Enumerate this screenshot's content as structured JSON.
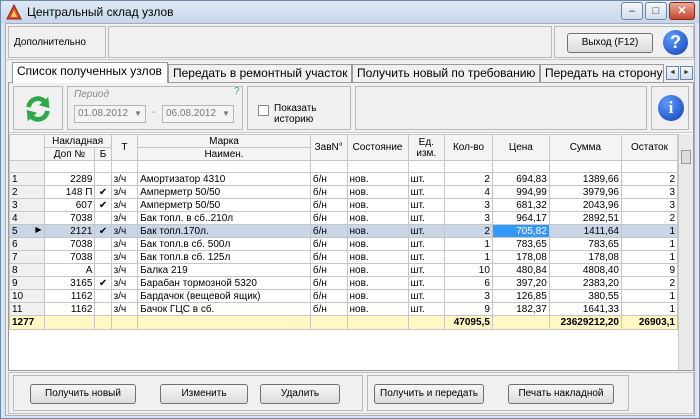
{
  "window": {
    "title": "Центральный склад узлов",
    "min": "–",
    "max": "□",
    "close": "✕"
  },
  "toolbar": {
    "extra_label": "Дополнительно",
    "exit_label": "Выход (F12)",
    "help_label": "?"
  },
  "tabs": [
    {
      "label": "Список полученных узлов"
    },
    {
      "label": "Передать в ремонтный участок"
    },
    {
      "label": "Получить новый по требованию"
    },
    {
      "label": "Передать на сторону"
    }
  ],
  "tab_nav": {
    "prev": "◄",
    "next": "►"
  },
  "filter": {
    "period_label": "Период",
    "date_from": "01.08.2012",
    "date_to": "06.08.2012",
    "dash": "-",
    "question": "?",
    "history_label": "Показать историю",
    "info_label": "i"
  },
  "grid": {
    "headers": {
      "nakl": "Накладная",
      "doc": "Доп №",
      "b": "Б",
      "t": "Т",
      "marka": "Марка",
      "naim": "Наимен.",
      "zav": "ЗавN°",
      "sost": "Состояние",
      "ed": "Ед. изм.",
      "kol": "Кол-во",
      "price": "Цена",
      "sum": "Сумма",
      "ost": "Остаток"
    },
    "rows": [
      {
        "n": "1",
        "doc": "2289",
        "b": "",
        "t": "з/ч",
        "name": "Амортизатор 4310",
        "zav": "б/н",
        "sost": "нов.",
        "ed": "шт.",
        "kol": "2",
        "price": "694,83",
        "sum": "1389,66",
        "ost": "2"
      },
      {
        "n": "2",
        "doc": "148 П",
        "b": "✔",
        "t": "з/ч",
        "name": "Амперметр 50/50",
        "zav": "б/н",
        "sost": "нов.",
        "ed": "шт.",
        "kol": "4",
        "price": "994,99",
        "sum": "3979,96",
        "ost": "3"
      },
      {
        "n": "3",
        "doc": "607",
        "b": "✔",
        "t": "з/ч",
        "name": "Амперметр 50/50",
        "zav": "б/н",
        "sost": "нов.",
        "ed": "шт.",
        "kol": "3",
        "price": "681,32",
        "sum": "2043,96",
        "ost": "3"
      },
      {
        "n": "4",
        "doc": "7038",
        "b": "",
        "t": "з/ч",
        "name": "Бак топл. в сб..210л",
        "zav": "б/н",
        "sost": "нов.",
        "ed": "шт.",
        "kol": "3",
        "price": "964,17",
        "sum": "2892,51",
        "ost": "2"
      },
      {
        "n": "5",
        "doc": "2121",
        "b": "✔",
        "t": "з/ч",
        "name": "Бак топл.170л.",
        "zav": "б/н",
        "sost": "нов.",
        "ed": "шт.",
        "kol": "2",
        "price": "705,82",
        "sum": "1411,64",
        "ost": "1"
      },
      {
        "n": "6",
        "doc": "7038",
        "b": "",
        "t": "з/ч",
        "name": "Бак топл.в сб.  500л",
        "zav": "б/н",
        "sost": "нов.",
        "ed": "шт.",
        "kol": "1",
        "price": "783,65",
        "sum": "783,65",
        "ost": "1"
      },
      {
        "n": "7",
        "doc": "7038",
        "b": "",
        "t": "з/ч",
        "name": "Бак топл.в сб. 125л",
        "zav": "б/н",
        "sost": "нов.",
        "ed": "шт.",
        "kol": "1",
        "price": "178,08",
        "sum": "178,08",
        "ost": "1"
      },
      {
        "n": "8",
        "doc": "А",
        "b": "",
        "t": "з/ч",
        "name": "Балка 219",
        "zav": "б/н",
        "sost": "нов.",
        "ed": "шт.",
        "kol": "10",
        "price": "480,84",
        "sum": "4808,40",
        "ost": "9"
      },
      {
        "n": "9",
        "doc": "3165",
        "b": "✔",
        "t": "з/ч",
        "name": "Барабан тормозной 5320",
        "zav": "б/н",
        "sost": "нов.",
        "ed": "шт.",
        "kol": "6",
        "price": "397,20",
        "sum": "2383,20",
        "ost": "2"
      },
      {
        "n": "10",
        "doc": "1162",
        "b": "",
        "t": "з/ч",
        "name": "Бардачок (вещевой ящик)",
        "zav": "б/н",
        "sost": "нов.",
        "ed": "шт.",
        "kol": "3",
        "price": "126,85",
        "sum": "380,55",
        "ost": "1"
      },
      {
        "n": "11",
        "doc": "1162",
        "b": "",
        "t": "з/ч",
        "name": "Бачок ГЦС в сб.",
        "zav": "б/н",
        "sost": "нов.",
        "ed": "шт.",
        "kol": "9",
        "price": "182,37",
        "sum": "1641,33",
        "ost": "1"
      }
    ],
    "totals": {
      "count": "1277",
      "kol": "47095,5",
      "sum": "23629212,20",
      "ost": "26903,1"
    }
  },
  "buttons": {
    "new": "Получить новый",
    "edit": "Изменить",
    "delete": "Удалить",
    "get_pass": "Получить и передать",
    "print": "Печать накладной"
  },
  "colors": {
    "selection": "#c8d6e8",
    "current_cell": "#3399ff",
    "totals": "#fff8c4"
  }
}
